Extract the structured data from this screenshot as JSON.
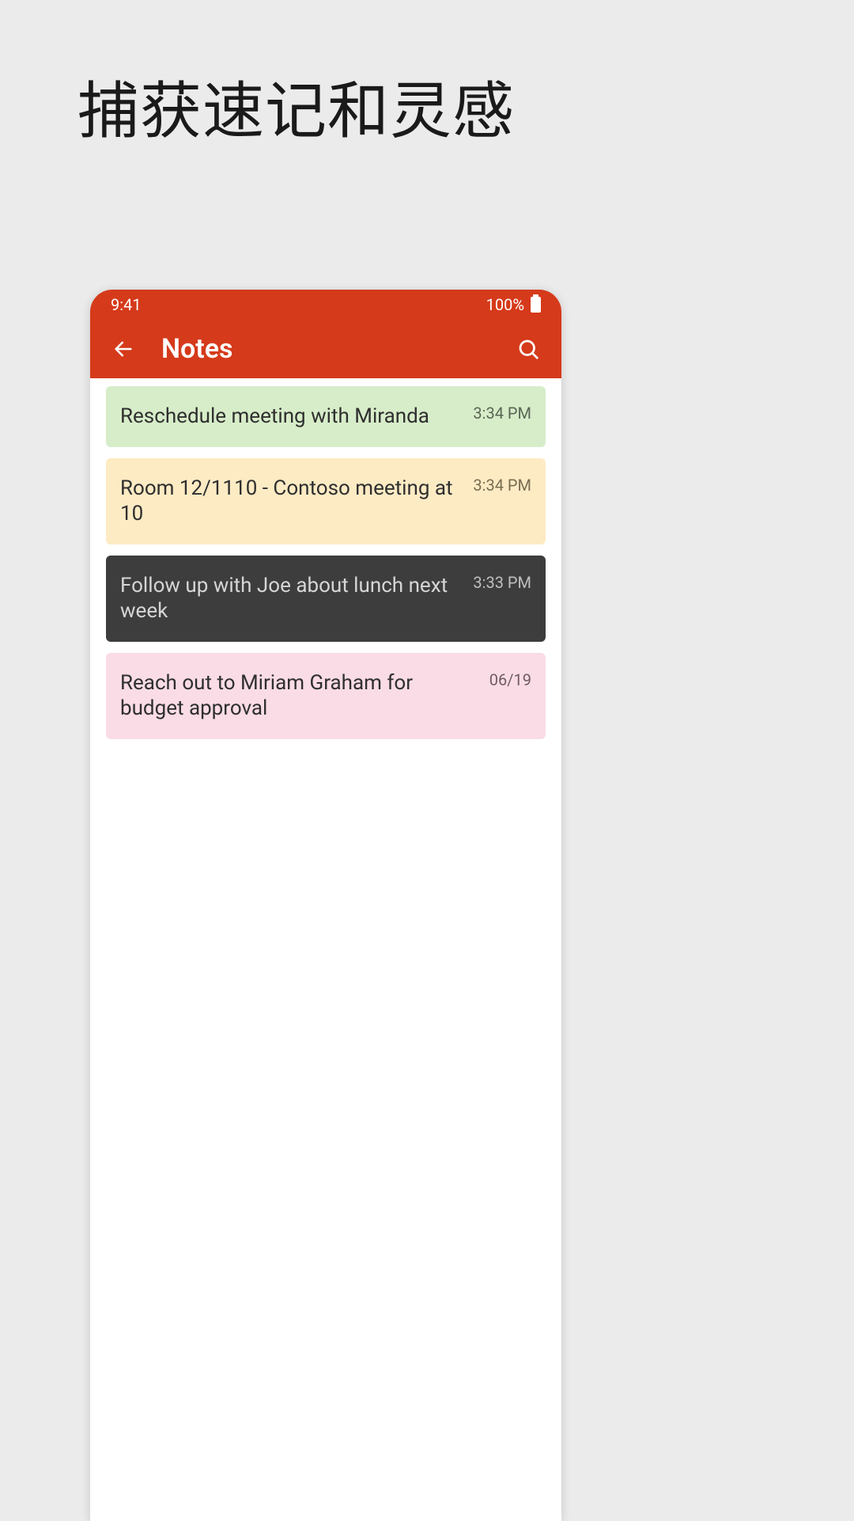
{
  "headline": "捕获速记和灵感",
  "statusBar": {
    "time": "9:41",
    "battery": "100%"
  },
  "appBar": {
    "title": "Notes"
  },
  "notes": [
    {
      "text": "Reschedule meeting with Miranda",
      "time": "3:34 PM",
      "colorClass": "note-green"
    },
    {
      "text": "Room 12/1110 - Contoso meeting at 10",
      "time": "3:34 PM",
      "colorClass": "note-yellow"
    },
    {
      "text": "Follow up with Joe about lunch next week",
      "time": "3:33 PM",
      "colorClass": "note-dark"
    },
    {
      "text": "Reach out to Miriam Graham for budget approval",
      "time": "06/19",
      "colorClass": "note-pink"
    }
  ]
}
